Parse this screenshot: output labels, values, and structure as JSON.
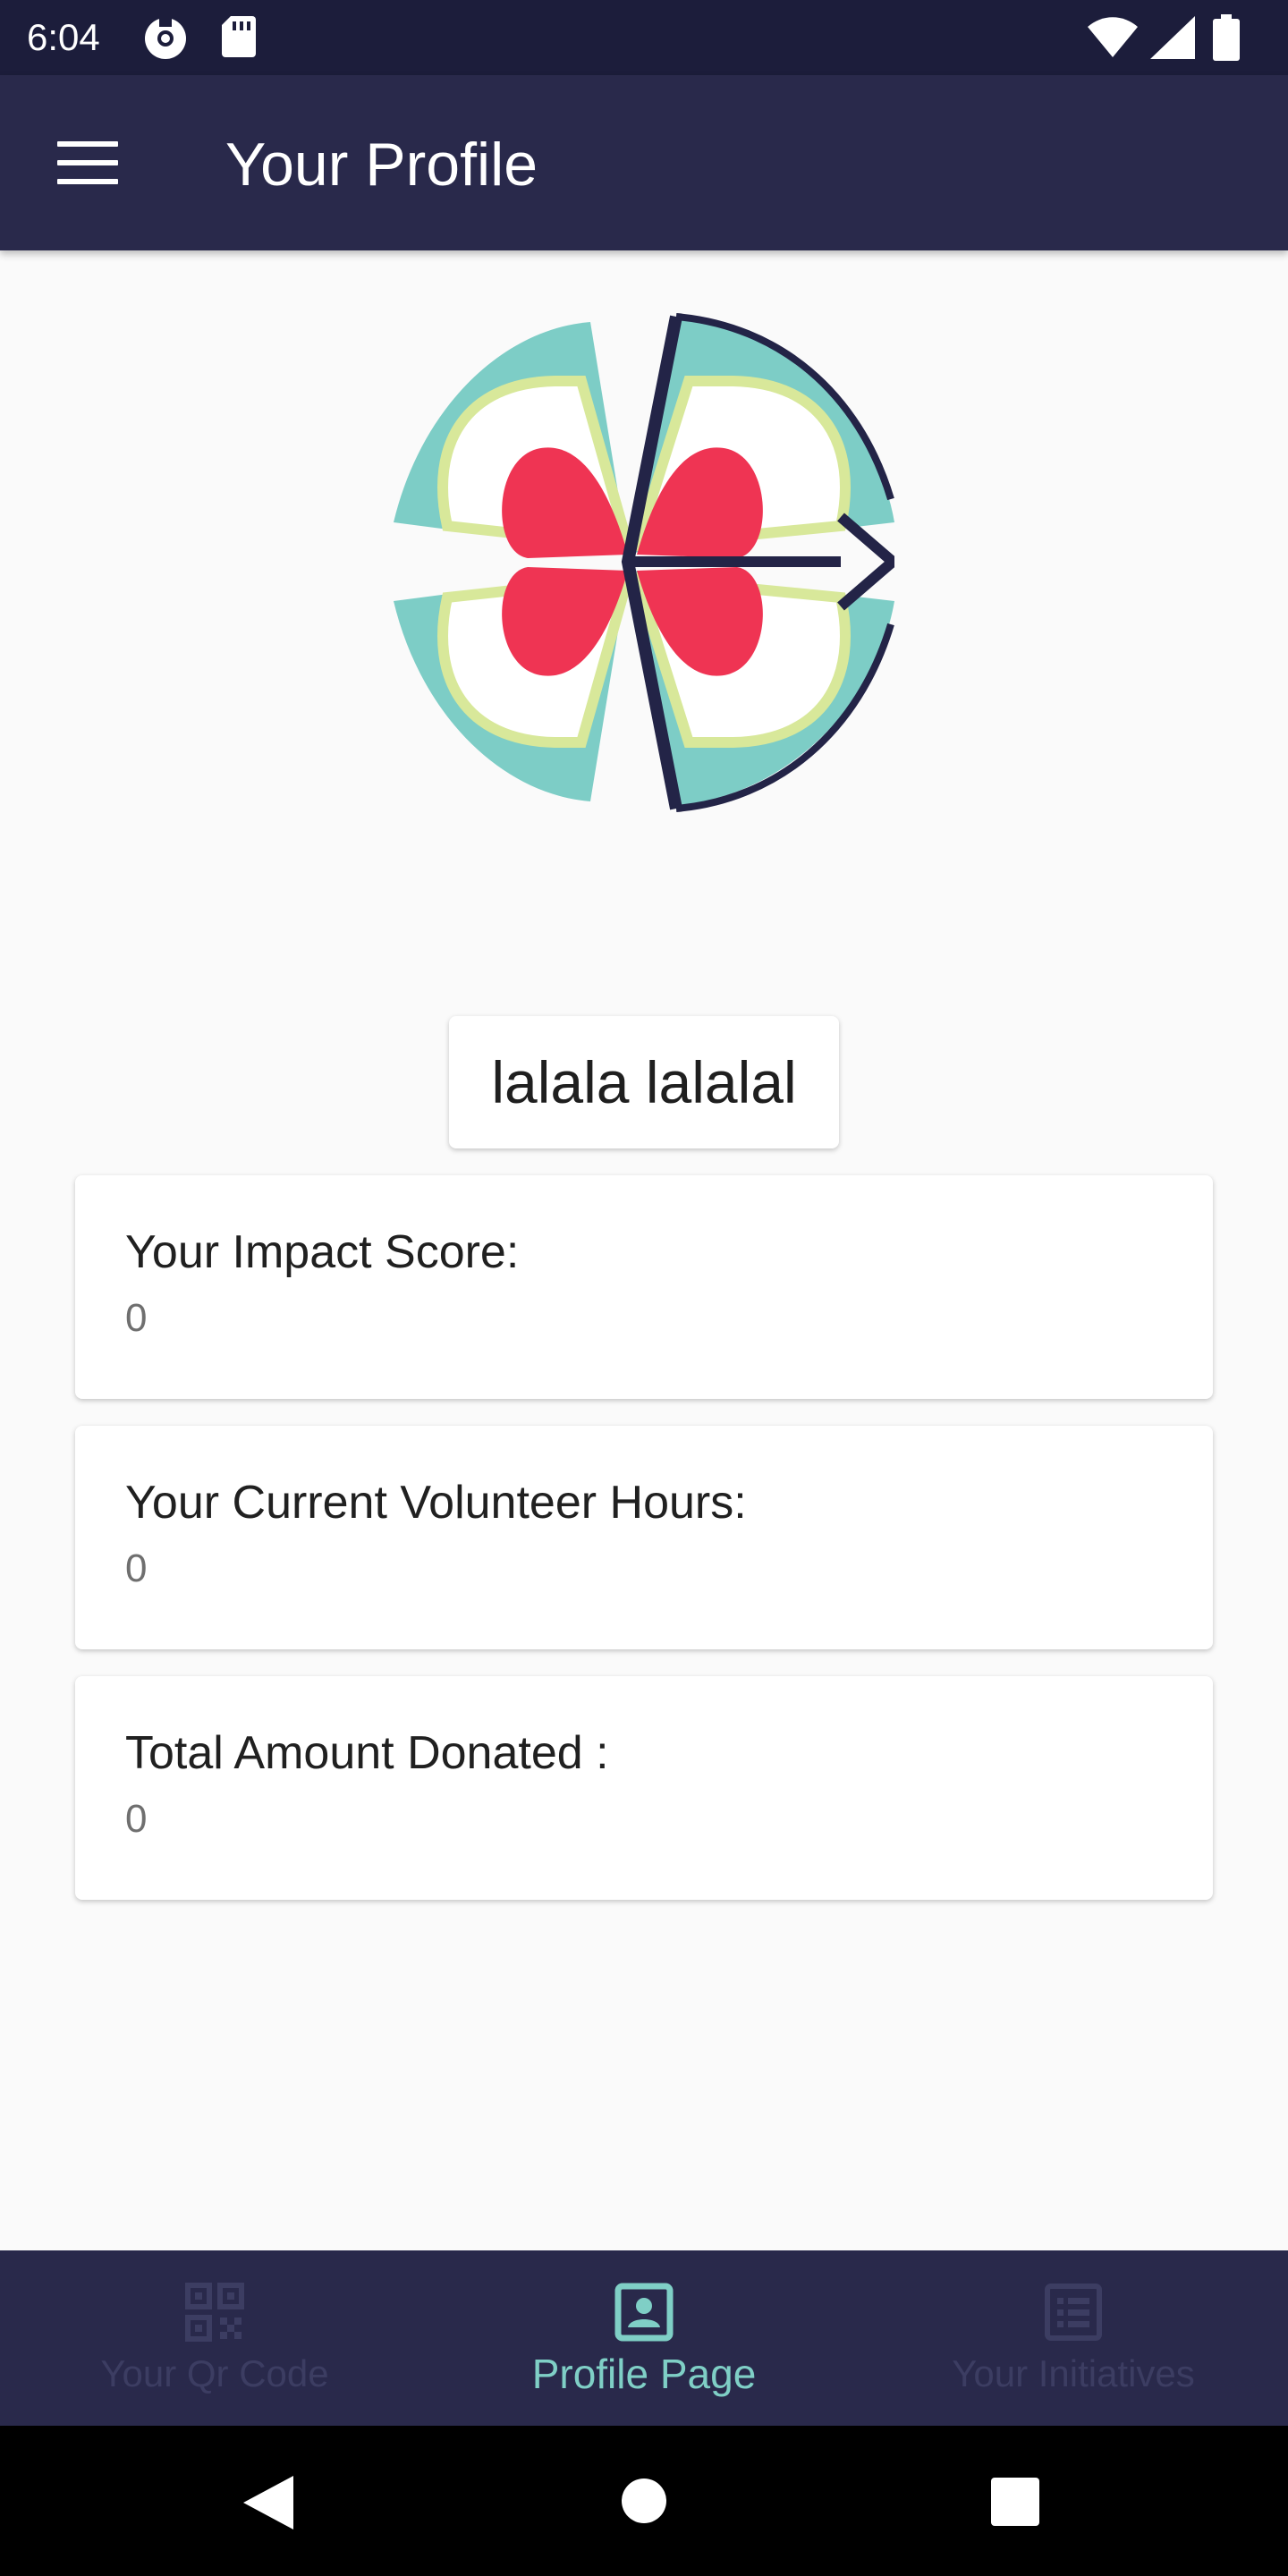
{
  "status_bar": {
    "time": "6:04",
    "icons": [
      "ubuntu-icon",
      "sd-card-icon",
      "wifi-icon",
      "signal-icon",
      "battery-icon"
    ]
  },
  "app_bar": {
    "title": "Your Profile",
    "menu_icon": "hamburger-menu-icon"
  },
  "profile": {
    "logo_icon": "flower-logo-icon",
    "name": "lalala lalalal"
  },
  "stats": [
    {
      "label": "Your Impact Score:",
      "value": "0"
    },
    {
      "label": "Your Current Volunteer Hours:",
      "value": "0"
    },
    {
      "label": "Total Amount Donated :",
      "value": "0"
    }
  ],
  "bottom_nav": {
    "items": [
      {
        "label": "Your Qr Code",
        "icon": "qr-code-icon",
        "active": false
      },
      {
        "label": "Profile Page",
        "icon": "profile-card-icon",
        "active": true
      },
      {
        "label": "Your Initiatives",
        "icon": "list-icon",
        "active": false
      }
    ]
  },
  "system_nav": {
    "icons": [
      "back-icon",
      "home-icon",
      "recents-icon"
    ]
  },
  "colors": {
    "status_bar": "#1c1d3b",
    "app_bar": "#29294b",
    "background": "#fafafa",
    "accent_active": "#7fcfc6",
    "nav_inactive": "#3c3d62",
    "logo_teal": "#7dcdc6",
    "logo_red": "#ef3453",
    "logo_lime": "#d8e89a",
    "logo_navy": "#232447"
  }
}
